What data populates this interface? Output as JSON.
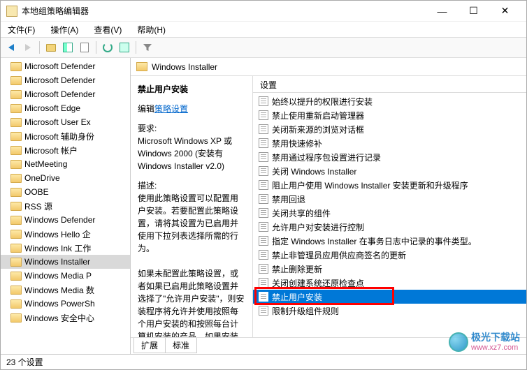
{
  "window": {
    "title": "本地组策略编辑器"
  },
  "menu": {
    "file": "文件(F)",
    "action": "操作(A)",
    "view": "查看(V)",
    "help": "帮助(H)"
  },
  "tree": {
    "items": [
      "Microsoft Defender",
      "Microsoft Defender",
      "Microsoft Defender",
      "Microsoft Edge",
      "Microsoft User Ex",
      "Microsoft 辅助身份",
      "Microsoft 帐户",
      "NetMeeting",
      "OneDrive",
      "OOBE",
      "RSS 源",
      "Windows Defender",
      "Windows Hello 企",
      "Windows Ink 工作",
      "Windows Installer",
      "Windows Media P",
      "Windows Media 数",
      "Windows PowerSh",
      "Windows 安全中心"
    ],
    "selected_index": 14
  },
  "right_header": "Windows Installer",
  "detail": {
    "heading": "禁止用户安装",
    "edit_prefix": "编辑",
    "edit_link": "策略设置",
    "req_label": "要求:",
    "req_text": "Microsoft Windows XP 或 Windows 2000 (安装有 Windows Installer v2.0)",
    "desc_label": "描述:",
    "desc_text": "使用此策略设置可以配置用户安装。若要配置此策略设置，请将其设置为已启用并使用下拉列表选择所需的行为。\n\n如果未配置此策略设置，或者如果已启用此策略设置并选择了\"允许用户安装\"，则安装程序将允许并使用按照每个用户安装的和按照每台计算机安装的产品。如果安装程序检测到某个应用程序是按照每个用"
  },
  "settings": {
    "header": "设置",
    "items": [
      "始终以提升的权限进行安装",
      "禁止使用重新启动管理器",
      "关闭新来源的浏览对话框",
      "禁用快速修补",
      "禁用通过程序包设置进行记录",
      "关闭 Windows Installer",
      "阻止用户使用 Windows Installer 安装更新和升级程序",
      "禁用回退",
      "关闭共享的组件",
      "允许用户对安装进行控制",
      "指定 Windows Installer 在事务日志中记录的事件类型。",
      "禁止非管理员应用供应商签名的更新",
      "禁止删除更新",
      "关闭创建系统还原检查点",
      "禁止用户安装",
      "限制升级组件规则"
    ],
    "selected_index": 14
  },
  "tabs": {
    "extended": "扩展",
    "standard": "标准"
  },
  "statusbar": "23 个设置",
  "watermark": {
    "cn": "极光下载站",
    "url": "www.xz7.com"
  }
}
